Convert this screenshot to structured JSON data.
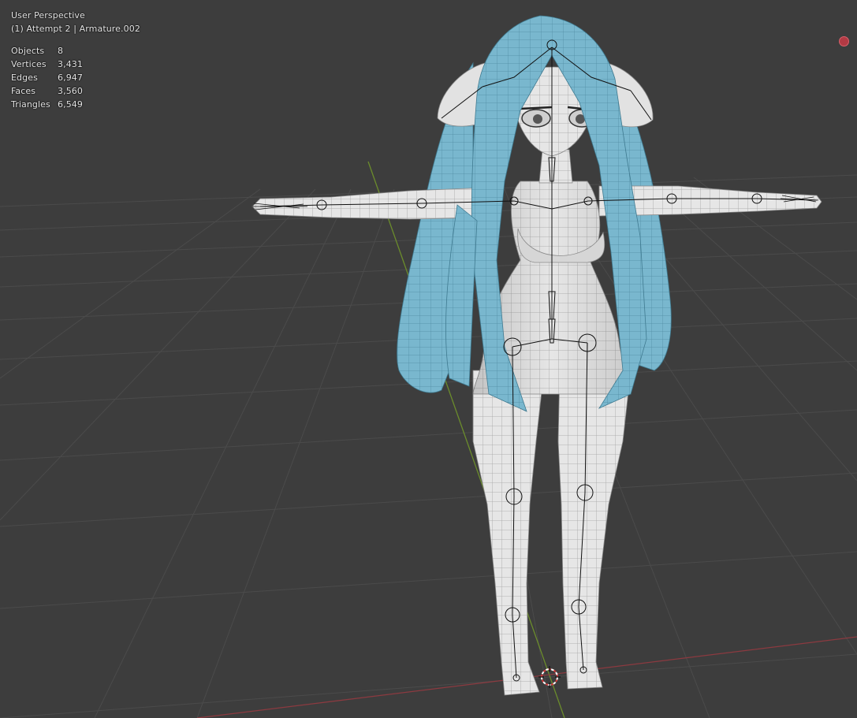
{
  "viewport": {
    "view_name": "User Perspective",
    "context_line": "(1) Attempt 2 | Armature.002",
    "stats": [
      {
        "label": "Objects",
        "value": "8"
      },
      {
        "label": "Vertices",
        "value": "3,431"
      },
      {
        "label": "Edges",
        "value": "6,947"
      },
      {
        "label": "Faces",
        "value": "3,560"
      },
      {
        "label": "Triangles",
        "value": "6,549"
      }
    ]
  },
  "colors": {
    "background": "#3d3d3d",
    "grid": "#4a4a4a",
    "x_axis": "#8a3a3f",
    "y_axis": "#6a8a2a",
    "mesh_body": "#e8e8e8",
    "mesh_wire": "#9a9a9a",
    "hair": "#7ab8cf",
    "armature": "#111111",
    "record_indicator": "#b33a44"
  },
  "icons": [
    "record-indicator-icon",
    "3d-cursor-icon"
  ]
}
